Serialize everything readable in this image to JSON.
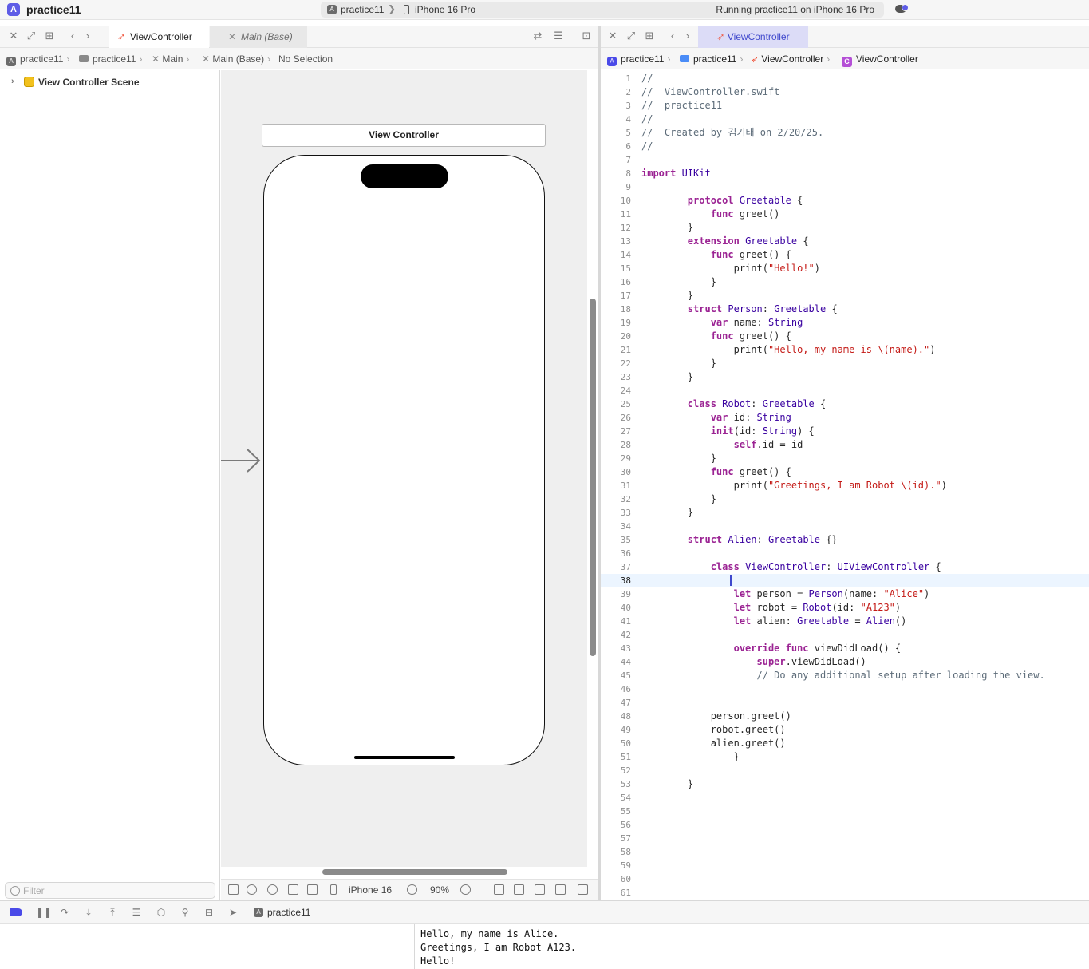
{
  "window": {
    "title": "practice11",
    "scheme": "practice11",
    "scheme_separator": "❯",
    "device": "iPhone 16 Pro",
    "status": "Running practice11 on iPhone 16 Pro"
  },
  "left_editor": {
    "tabs": [
      {
        "label": "ViewController",
        "icon": "swift-file-icon",
        "active": true
      },
      {
        "label": "Main (Base)",
        "icon": "storyboard-icon",
        "active": false
      }
    ],
    "breadcrumb": [
      "practice11",
      "practice11",
      "Main",
      "Main (Base)",
      "No Selection"
    ],
    "outline": {
      "scene": "View Controller Scene"
    },
    "filter_placeholder": "Filter",
    "canvas": {
      "view_controller_title": "View Controller"
    },
    "canvas_toolbar": {
      "device": "iPhone 16",
      "zoom": "90%"
    }
  },
  "right_editor": {
    "tab": "ViewController",
    "breadcrumb": [
      "practice11",
      "practice11",
      "ViewController",
      "ViewController"
    ],
    "current_line": 38,
    "lines": [
      "//",
      "//  ViewController.swift",
      "//  practice11",
      "//",
      "//  Created by 김기태 on 2/20/25.",
      "//",
      "",
      "import UIKit",
      "",
      "        protocol Greetable {",
      "            func greet()",
      "        }",
      "        extension Greetable {",
      "            func greet() {",
      "                print(\"Hello!\")",
      "            }",
      "        }",
      "        struct Person: Greetable {",
      "            var name: String",
      "            func greet() {",
      "                print(\"Hello, my name is \\(name).\")",
      "            }",
      "        }",
      "",
      "        class Robot: Greetable {",
      "            var id: String",
      "            init(id: String) {",
      "                self.id = id",
      "            }",
      "            func greet() {",
      "                print(\"Greetings, I am Robot \\(id).\")",
      "            }",
      "        }",
      "",
      "        struct Alien: Greetable {}",
      "",
      "            class ViewController: UIViewController {",
      "",
      "                let person = Person(name: \"Alice\")",
      "                let robot = Robot(id: \"A123\")",
      "                let alien: Greetable = Alien()",
      "",
      "                override func viewDidLoad() {",
      "                    super.viewDidLoad()",
      "                    // Do any additional setup after loading the view.",
      "",
      "",
      "            person.greet()",
      "            robot.greet()",
      "            alien.greet()",
      "                }",
      "",
      "        }",
      "",
      "",
      "",
      "",
      "",
      "",
      "",
      ""
    ]
  },
  "debug_bar": {
    "target": "practice11"
  },
  "console": {
    "output": [
      "Hello, my name is Alice.",
      "Greetings, I am Robot A123.",
      "Hello!"
    ]
  },
  "colors": {
    "accent": "#5e5ce6",
    "keyword": "#9b2393",
    "type": "#3900a0",
    "string": "#c41a16",
    "comment": "#5d6c79",
    "current_line": "#ecf5ff"
  }
}
